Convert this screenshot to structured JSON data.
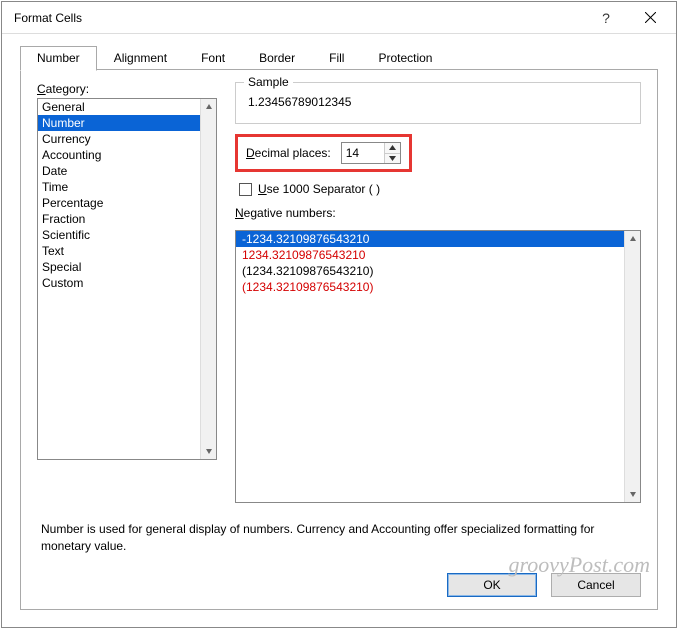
{
  "title": "Format Cells",
  "tabs": [
    "Number",
    "Alignment",
    "Font",
    "Border",
    "Fill",
    "Protection"
  ],
  "active_tab": 0,
  "category_label": "Category:",
  "categories": [
    "General",
    "Number",
    "Currency",
    "Accounting",
    "Date",
    "Time",
    "Percentage",
    "Fraction",
    "Scientific",
    "Text",
    "Special",
    "Custom"
  ],
  "category_selected": 1,
  "sample": {
    "legend": "Sample",
    "value": "1.23456789012345"
  },
  "decimal": {
    "label": "Decimal places:",
    "value": "14"
  },
  "separator": {
    "label": "Use 1000 Separator ( )",
    "checked": false
  },
  "negative": {
    "label": "Negative numbers:",
    "items": [
      {
        "text": "-1234.32109876543210",
        "style": "sel"
      },
      {
        "text": "1234.32109876543210",
        "style": "red"
      },
      {
        "text": "(1234.32109876543210)",
        "style": ""
      },
      {
        "text": "(1234.32109876543210)",
        "style": "red"
      }
    ]
  },
  "description": "Number is used for general display of numbers.  Currency and Accounting offer specialized formatting for monetary value.",
  "buttons": {
    "ok": "OK",
    "cancel": "Cancel"
  },
  "watermark": "groovyPost.com"
}
